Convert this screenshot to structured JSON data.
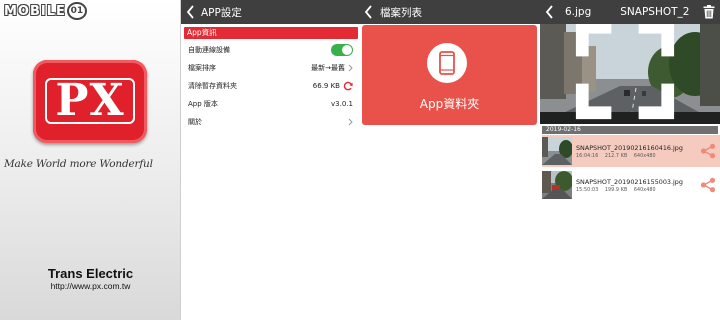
{
  "watermark": {
    "text": "MOBILE",
    "badge": "01"
  },
  "brand": {
    "logo_text": "PX",
    "slogan": "Make World more Wonderful",
    "company": "Trans Electric",
    "url": "http://www.px.com.tw"
  },
  "settings": {
    "title": "APP設定",
    "section": "App資訊",
    "rows": [
      {
        "label": "自動連線設備",
        "value": ""
      },
      {
        "label": "檔案排序",
        "value": "最新→最舊"
      },
      {
        "label": "清除暫存資料夾",
        "value": "66.9 KB"
      },
      {
        "label": "App 版本",
        "value": "v3.0.1"
      },
      {
        "label": "關於",
        "value": ""
      }
    ],
    "auto_connect_enabled": true
  },
  "files": {
    "title": "檔案列表",
    "folder_label": "App資料夾",
    "accent": "#e8524a"
  },
  "viewer": {
    "title_left": "6.jpg",
    "title_right": "SNAPSHOT_2",
    "date": "2019-02-16",
    "items": [
      {
        "name": "SNAPSHOT_20190216160416.jpg",
        "time": "16:04:16",
        "size": "212.7 KB",
        "resolution": "640x480",
        "selected": true
      },
      {
        "name": "SNAPSHOT_20190216155003.jpg",
        "time": "15:50:03",
        "size": "199.9 KB",
        "resolution": "640x480",
        "selected": false
      }
    ]
  },
  "colors": {
    "topbar": "#3f3f3f",
    "brand_red": "#e0212b",
    "toggle_on": "#37b24a",
    "share": "#f08a7a"
  }
}
